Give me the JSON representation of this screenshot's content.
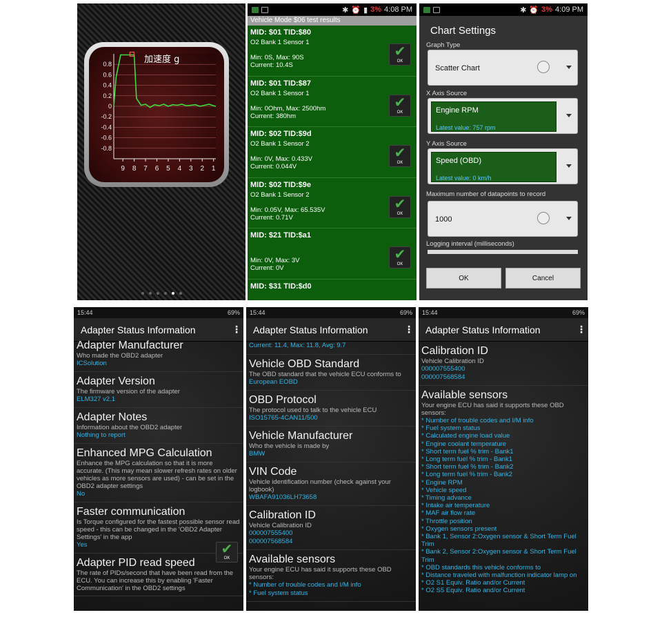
{
  "panel1": {
    "chart_data": {
      "type": "line",
      "title": "加速度 g",
      "yticks": [
        "0.8",
        "0.6",
        "0.4",
        "0.2",
        "0",
        "-0.2",
        "-0.4",
        "-0.6",
        "-0.8"
      ],
      "xticks": [
        "9",
        "8",
        "7",
        "6",
        "5",
        "4",
        "3",
        "2",
        "1"
      ],
      "ylim": [
        -1,
        1
      ],
      "x": [
        0,
        0.2,
        0.6,
        0.8,
        1.2,
        1.4,
        1.6,
        1.8,
        2.0,
        2.4,
        2.8,
        3.2,
        3.6,
        4.0,
        4.4,
        4.8,
        5.2,
        5.6,
        6.0,
        6.4,
        6.8,
        7.2,
        7.6,
        8.0,
        8.4,
        8.8,
        9.0
      ],
      "values": [
        0,
        0.55,
        0.98,
        0.98,
        0.98,
        0.98,
        0.98,
        0.98,
        0.15,
        0.02,
        0.04,
        -0.02,
        0.03,
        0.01,
        0.04,
        0,
        0.03,
        0.02,
        0.04,
        0.01,
        0.02,
        0.03,
        0,
        0.02,
        0.04,
        0.01,
        0
      ],
      "xlim": [
        0,
        9
      ]
    },
    "page_dots": 6,
    "active_dot": 4
  },
  "panel2": {
    "status": {
      "time": "4:08 PM",
      "battery": "3%"
    },
    "header": "Vehicle Mode $06 test results",
    "results": [
      {
        "title": "MID: $01 TID:$80",
        "sensor": "O2 Bank 1 Sensor 1",
        "range": "Min: 0S, Max: 90S",
        "current": "Current: 10.4S",
        "ok": "OK"
      },
      {
        "title": "MID: $01 TID:$87",
        "sensor": "O2 Bank 1 Sensor 1",
        "range": "Min: 0Ohm, Max: 2500hm",
        "current": "Current: 380hm",
        "ok": "OK"
      },
      {
        "title": "MID: $02 TID:$9d",
        "sensor": "O2 Bank 1 Sensor 2",
        "range": "Min: 0V, Max: 0.433V",
        "current": "Current: 0.044V",
        "ok": "OK"
      },
      {
        "title": "MID: $02 TID:$9e",
        "sensor": "O2 Bank 1 Sensor 2",
        "range": "Min: 0.05V, Max: 65.535V",
        "current": "Current: 0.71V",
        "ok": "OK"
      },
      {
        "title": "MID: $21 TID:$a1",
        "sensor": "",
        "range": "Min: 0V, Max: 3V",
        "current": "Current: 0V",
        "ok": "OK"
      },
      {
        "title": "MID: $31 TID:$d0",
        "sensor": "",
        "range": "",
        "current": "",
        "ok": ""
      }
    ]
  },
  "panel3": {
    "status": {
      "time": "4:09 PM",
      "battery": "3%"
    },
    "title": "Chart Settings",
    "graph_type_label": "Graph Type",
    "graph_type": "Scatter Chart",
    "x_label": "X Axis Source",
    "x_source": "Engine RPM",
    "x_latest": "Latest value: 757 rpm",
    "y_label": "Y Axis Source",
    "y_source": "Speed (OBD)",
    "y_latest": "Latest value: 0 km/h",
    "max_label": "Maximum number of datapoints to record",
    "max_value": "1000",
    "interval_label": "Logging interval (milliseconds)",
    "ok": "OK",
    "cancel": "Cancel"
  },
  "bottom": {
    "status": {
      "time": "15:44",
      "battery": "69%"
    },
    "title": "Adapter Status Information",
    "menu": "⋮",
    "p4": [
      {
        "h": "Adapter Manufacturer",
        "d": "Who made the OBD2 adapter",
        "v": "ICSolution"
      },
      {
        "h": "Adapter Version",
        "d": "The firmware version of the adapter",
        "v": "ELM327 v2.1"
      },
      {
        "h": "Adapter Notes",
        "d": "Information about the OBD2 adapter",
        "v": "Nothing to report"
      },
      {
        "h": "Enhanced MPG Calculation",
        "d": "Enhance the MPG calculation so that it is more accurate. (This may mean slower refresh rates on older vehicles as more sensors are used) - can be set in the OBD2 adapter settings",
        "v": "No"
      },
      {
        "h": "Faster communication",
        "d": "Is Torque configured for the fastest possible sensor read speed - this can be changed in the 'OBD2 Adapter Settings' in the app",
        "v": "Yes"
      },
      {
        "h": "Adapter PID read speed",
        "d": "The rate of PIDs/second that have been read from the ECU. You can increase this by enabling 'Faster Communication' in the OBD2 settings",
        "v": ""
      }
    ],
    "p5_top": "Current: 11.4, Max: 11.8, Avg: 9.7",
    "p5": [
      {
        "h": "Vehicle OBD Standard",
        "d": "The OBD standard that the vehicle ECU conforms to",
        "v": "European EOBD"
      },
      {
        "h": "OBD Protocol",
        "d": "The protocol used to talk to the vehicle ECU",
        "v": "ISO15765-4CAN11/500"
      },
      {
        "h": "Vehicle Manufacturer",
        "d": "Who the vehicle is made by",
        "v": "BMW"
      },
      {
        "h": "VIN Code",
        "d": "Vehicle identification number (check against your logbook)",
        "v": "WBAFA91036LH73658"
      },
      {
        "h": "Calibration ID",
        "d": "Vehicle Calibration ID",
        "v": "000007555400",
        "v2": "000007568584"
      },
      {
        "h": "Available sensors",
        "d": "Your engine ECU has said it supports these OBD sensors:",
        "v": "* Number of trouble codes and I/M info",
        "v2": "* Fuel system status"
      }
    ],
    "p6_cal": {
      "h": "Calibration ID",
      "d": "Vehicle Calibration ID",
      "v": "000007555400",
      "v2": "000007568584"
    },
    "p6_avail": {
      "h": "Available sensors",
      "d": "Your engine ECU has said it supports these OBD sensors:"
    },
    "sensors": [
      "* Number of trouble codes and I/M info",
      "* Fuel system status",
      "* Calculated engine load value",
      "* Engine coolant temperature",
      "* Short term fuel % trim - Bank1",
      "* Long term fuel % trim - Bank1",
      "* Short term fuel % trim - Bank2",
      "* Long term fuel % trim - Bank2",
      "* Engine RPM",
      "* Vehicle speed",
      "* Timing advance",
      "* Intake air temperature",
      "* MAF air flow rate",
      "* Throttle position",
      "* Oxygen sensors present",
      "* Bank 1, Sensor 2:Oxygen sensor & Short Term Fuel Trim",
      "* Bank 2, Sensor 2:Oxygen sensor & Short Term Fuel Trim",
      "* OBD standards this vehicle conforms to",
      "* Distance traveled with malfunction indicator lamp on",
      "* O2 S1 Equiv. Ratio and/or Current",
      "* O2 S5 Equiv. Ratio and/or Current"
    ]
  },
  "colors": {
    "accent_blue": "#33b5e5",
    "ok_green": "#4caf50",
    "panel_green": "#0c5d0c"
  }
}
